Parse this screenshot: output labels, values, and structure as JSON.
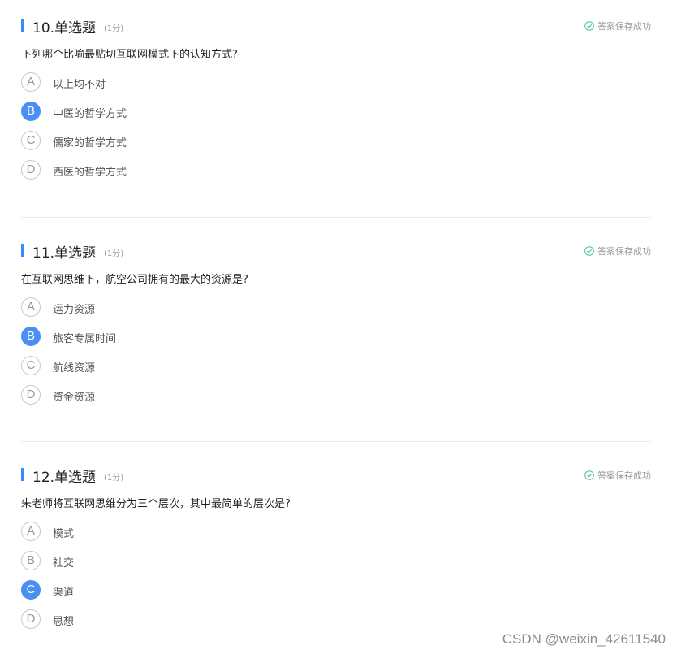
{
  "questions": [
    {
      "number": "10.单选题",
      "score": "(1分)",
      "status": "答案保存成功",
      "stem": "下列哪个比喻最贴切互联网模式下的认知方式?",
      "options": [
        {
          "letter": "A",
          "text": "以上均不对",
          "selected": false
        },
        {
          "letter": "B",
          "text": "中医的哲学方式",
          "selected": true
        },
        {
          "letter": "C",
          "text": "儒家的哲学方式",
          "selected": false
        },
        {
          "letter": "D",
          "text": "西医的哲学方式",
          "selected": false
        }
      ]
    },
    {
      "number": "11.单选题",
      "score": "(1分)",
      "status": "答案保存成功",
      "stem": "在互联网思维下，航空公司拥有的最大的资源是?",
      "options": [
        {
          "letter": "A",
          "text": "运力资源",
          "selected": false
        },
        {
          "letter": "B",
          "text": "旅客专属时间",
          "selected": true
        },
        {
          "letter": "C",
          "text": "航线资源",
          "selected": false
        },
        {
          "letter": "D",
          "text": "资金资源",
          "selected": false
        }
      ]
    },
    {
      "number": "12.单选题",
      "score": "(1分)",
      "status": "答案保存成功",
      "stem": "朱老师将互联网思维分为三个层次，其中最简单的层次是?",
      "options": [
        {
          "letter": "A",
          "text": "模式",
          "selected": false
        },
        {
          "letter": "B",
          "text": "社交",
          "selected": false
        },
        {
          "letter": "C",
          "text": "渠道",
          "selected": true
        },
        {
          "letter": "D",
          "text": "思想",
          "selected": false
        }
      ]
    }
  ],
  "icons": {
    "status": "check-circle-icon"
  },
  "colors": {
    "accent": "#3a8bff",
    "selected_option": "#4a8ff2",
    "status_check": "#4cc38a"
  },
  "watermark": "CSDN @weixin_42611540"
}
